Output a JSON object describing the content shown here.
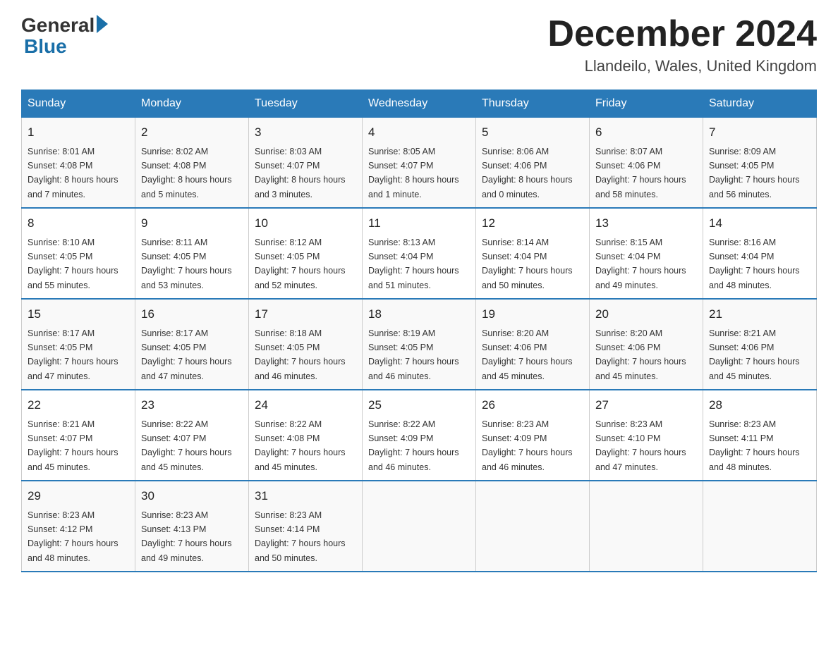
{
  "header": {
    "logo_general": "General",
    "logo_blue": "Blue",
    "title": "December 2024",
    "location": "Llandeilo, Wales, United Kingdom"
  },
  "calendar": {
    "days": [
      "Sunday",
      "Monday",
      "Tuesday",
      "Wednesday",
      "Thursday",
      "Friday",
      "Saturday"
    ],
    "weeks": [
      [
        {
          "date": "1",
          "sunrise": "8:01 AM",
          "sunset": "4:08 PM",
          "daylight": "8 hours and 7 minutes."
        },
        {
          "date": "2",
          "sunrise": "8:02 AM",
          "sunset": "4:08 PM",
          "daylight": "8 hours and 5 minutes."
        },
        {
          "date": "3",
          "sunrise": "8:03 AM",
          "sunset": "4:07 PM",
          "daylight": "8 hours and 3 minutes."
        },
        {
          "date": "4",
          "sunrise": "8:05 AM",
          "sunset": "4:07 PM",
          "daylight": "8 hours and 1 minute."
        },
        {
          "date": "5",
          "sunrise": "8:06 AM",
          "sunset": "4:06 PM",
          "daylight": "8 hours and 0 minutes."
        },
        {
          "date": "6",
          "sunrise": "8:07 AM",
          "sunset": "4:06 PM",
          "daylight": "7 hours and 58 minutes."
        },
        {
          "date": "7",
          "sunrise": "8:09 AM",
          "sunset": "4:05 PM",
          "daylight": "7 hours and 56 minutes."
        }
      ],
      [
        {
          "date": "8",
          "sunrise": "8:10 AM",
          "sunset": "4:05 PM",
          "daylight": "7 hours and 55 minutes."
        },
        {
          "date": "9",
          "sunrise": "8:11 AM",
          "sunset": "4:05 PM",
          "daylight": "7 hours and 53 minutes."
        },
        {
          "date": "10",
          "sunrise": "8:12 AM",
          "sunset": "4:05 PM",
          "daylight": "7 hours and 52 minutes."
        },
        {
          "date": "11",
          "sunrise": "8:13 AM",
          "sunset": "4:04 PM",
          "daylight": "7 hours and 51 minutes."
        },
        {
          "date": "12",
          "sunrise": "8:14 AM",
          "sunset": "4:04 PM",
          "daylight": "7 hours and 50 minutes."
        },
        {
          "date": "13",
          "sunrise": "8:15 AM",
          "sunset": "4:04 PM",
          "daylight": "7 hours and 49 minutes."
        },
        {
          "date": "14",
          "sunrise": "8:16 AM",
          "sunset": "4:04 PM",
          "daylight": "7 hours and 48 minutes."
        }
      ],
      [
        {
          "date": "15",
          "sunrise": "8:17 AM",
          "sunset": "4:05 PM",
          "daylight": "7 hours and 47 minutes."
        },
        {
          "date": "16",
          "sunrise": "8:17 AM",
          "sunset": "4:05 PM",
          "daylight": "7 hours and 47 minutes."
        },
        {
          "date": "17",
          "sunrise": "8:18 AM",
          "sunset": "4:05 PM",
          "daylight": "7 hours and 46 minutes."
        },
        {
          "date": "18",
          "sunrise": "8:19 AM",
          "sunset": "4:05 PM",
          "daylight": "7 hours and 46 minutes."
        },
        {
          "date": "19",
          "sunrise": "8:20 AM",
          "sunset": "4:06 PM",
          "daylight": "7 hours and 45 minutes."
        },
        {
          "date": "20",
          "sunrise": "8:20 AM",
          "sunset": "4:06 PM",
          "daylight": "7 hours and 45 minutes."
        },
        {
          "date": "21",
          "sunrise": "8:21 AM",
          "sunset": "4:06 PM",
          "daylight": "7 hours and 45 minutes."
        }
      ],
      [
        {
          "date": "22",
          "sunrise": "8:21 AM",
          "sunset": "4:07 PM",
          "daylight": "7 hours and 45 minutes."
        },
        {
          "date": "23",
          "sunrise": "8:22 AM",
          "sunset": "4:07 PM",
          "daylight": "7 hours and 45 minutes."
        },
        {
          "date": "24",
          "sunrise": "8:22 AM",
          "sunset": "4:08 PM",
          "daylight": "7 hours and 45 minutes."
        },
        {
          "date": "25",
          "sunrise": "8:22 AM",
          "sunset": "4:09 PM",
          "daylight": "7 hours and 46 minutes."
        },
        {
          "date": "26",
          "sunrise": "8:23 AM",
          "sunset": "4:09 PM",
          "daylight": "7 hours and 46 minutes."
        },
        {
          "date": "27",
          "sunrise": "8:23 AM",
          "sunset": "4:10 PM",
          "daylight": "7 hours and 47 minutes."
        },
        {
          "date": "28",
          "sunrise": "8:23 AM",
          "sunset": "4:11 PM",
          "daylight": "7 hours and 48 minutes."
        }
      ],
      [
        {
          "date": "29",
          "sunrise": "8:23 AM",
          "sunset": "4:12 PM",
          "daylight": "7 hours and 48 minutes."
        },
        {
          "date": "30",
          "sunrise": "8:23 AM",
          "sunset": "4:13 PM",
          "daylight": "7 hours and 49 minutes."
        },
        {
          "date": "31",
          "sunrise": "8:23 AM",
          "sunset": "4:14 PM",
          "daylight": "7 hours and 50 minutes."
        },
        null,
        null,
        null,
        null
      ]
    ],
    "labels": {
      "sunrise": "Sunrise:",
      "sunset": "Sunset:",
      "daylight": "Daylight:"
    }
  }
}
